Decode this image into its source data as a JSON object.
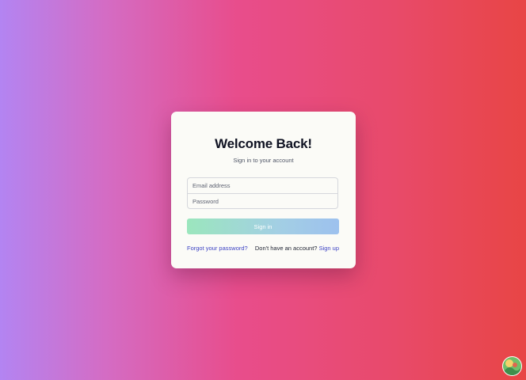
{
  "login": {
    "title": "Welcome Back!",
    "subtitle": "Sign in to your account",
    "email_placeholder": "Email address",
    "password_placeholder": "Password",
    "signin_label": "Sign in",
    "forgot_label": "Forgot your password?",
    "no_account_text": "Don't have an account?",
    "signup_label": "Sign up"
  },
  "corner_widget": {
    "icon": "avatar-icon"
  },
  "colors": {
    "background_gradient": [
      "#b384f2",
      "#d46cc4",
      "#e84d8c",
      "#e84a6a",
      "#e84545"
    ],
    "card": "#fbfbf7",
    "title": "#0f1222",
    "link": "#3d43c4",
    "button_gradient": [
      "#9be6bd",
      "#a3cfe4",
      "#9dc1ee"
    ]
  }
}
